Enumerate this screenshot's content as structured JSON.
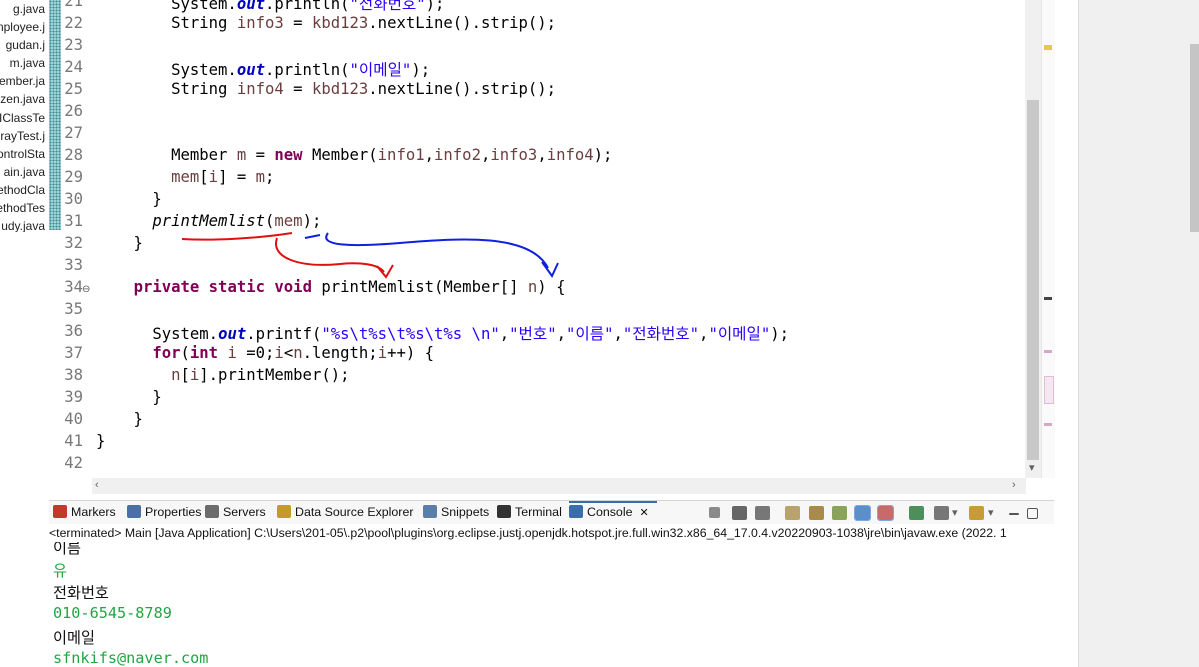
{
  "package_explorer": {
    "files": [
      "g.java",
      "nployee.j",
      "gudan.j",
      "m.java",
      "ember.ja",
      "ezen.java",
      "IClassTe",
      "rayTest.j",
      "ontrolSta",
      "ain.java",
      "ethodCla",
      "ethodTes",
      "udy.java"
    ]
  },
  "editor": {
    "lines": [
      {
        "n": "21",
        "t": [
          {
            "s": "        System."
          },
          {
            "s": "out",
            "c": "fld"
          },
          {
            "s": ".println("
          },
          {
            "s": "\"전화번호\"",
            "c": "str"
          },
          {
            "s": ");"
          }
        ]
      },
      {
        "n": "22",
        "t": [
          {
            "s": "        String "
          },
          {
            "s": "info3",
            "c": "var"
          },
          {
            "s": " = "
          },
          {
            "s": "kbd123",
            "c": "var"
          },
          {
            "s": ".nextLine().strip();"
          }
        ]
      },
      {
        "n": "23",
        "t": []
      },
      {
        "n": "24",
        "t": [
          {
            "s": "        System."
          },
          {
            "s": "out",
            "c": "fld"
          },
          {
            "s": ".println("
          },
          {
            "s": "\"이메일\"",
            "c": "str"
          },
          {
            "s": ");"
          }
        ]
      },
      {
        "n": "25",
        "t": [
          {
            "s": "        String "
          },
          {
            "s": "info4",
            "c": "var"
          },
          {
            "s": " = "
          },
          {
            "s": "kbd123",
            "c": "var"
          },
          {
            "s": ".nextLine().strip();"
          }
        ]
      },
      {
        "n": "26",
        "t": []
      },
      {
        "n": "27",
        "t": []
      },
      {
        "n": "28",
        "t": [
          {
            "s": "        Member "
          },
          {
            "s": "m",
            "c": "var"
          },
          {
            "s": " = "
          },
          {
            "s": "new",
            "c": "kw"
          },
          {
            "s": " Member("
          },
          {
            "s": "info1",
            "c": "var"
          },
          {
            "s": ","
          },
          {
            "s": "info2",
            "c": "var"
          },
          {
            "s": ","
          },
          {
            "s": "info3",
            "c": "var"
          },
          {
            "s": ","
          },
          {
            "s": "info4",
            "c": "var"
          },
          {
            "s": ");"
          }
        ]
      },
      {
        "n": "29",
        "t": [
          {
            "s": "        "
          },
          {
            "s": "mem",
            "c": "var"
          },
          {
            "s": "["
          },
          {
            "s": "i",
            "c": "var"
          },
          {
            "s": "] = "
          },
          {
            "s": "m",
            "c": "var"
          },
          {
            "s": ";"
          }
        ]
      },
      {
        "n": "30",
        "t": [
          {
            "s": "      }"
          }
        ]
      },
      {
        "n": "31",
        "t": [
          {
            "s": "      "
          },
          {
            "s": "printMemlist",
            "c": "mit"
          },
          {
            "s": "("
          },
          {
            "s": "mem",
            "c": "var"
          },
          {
            "s": ");"
          }
        ]
      },
      {
        "n": "32",
        "t": [
          {
            "s": "    }"
          }
        ]
      },
      {
        "n": "33",
        "t": []
      },
      {
        "n": "34",
        "t": [
          {
            "s": "    "
          },
          {
            "s": "private",
            "c": "kw"
          },
          {
            "s": " "
          },
          {
            "s": "static",
            "c": "kw"
          },
          {
            "s": " "
          },
          {
            "s": "void",
            "c": "kw"
          },
          {
            "s": " printMemlist(Member[] "
          },
          {
            "s": "n",
            "c": "var"
          },
          {
            "s": ") {"
          }
        ]
      },
      {
        "n": "35",
        "t": []
      },
      {
        "n": "36",
        "t": [
          {
            "s": "      System."
          },
          {
            "s": "out",
            "c": "fld"
          },
          {
            "s": ".printf("
          },
          {
            "s": "\"%s\\t%s\\t%s\\t%s \\n\"",
            "c": "str"
          },
          {
            "s": ","
          },
          {
            "s": "\"번호\"",
            "c": "str"
          },
          {
            "s": ","
          },
          {
            "s": "\"이름\"",
            "c": "str"
          },
          {
            "s": ","
          },
          {
            "s": "\"전화번호\"",
            "c": "str"
          },
          {
            "s": ","
          },
          {
            "s": "\"이메일\"",
            "c": "str"
          },
          {
            "s": ");"
          }
        ]
      },
      {
        "n": "37",
        "t": [
          {
            "s": "      "
          },
          {
            "s": "for",
            "c": "kw"
          },
          {
            "s": "("
          },
          {
            "s": "int",
            "c": "kw"
          },
          {
            "s": " "
          },
          {
            "s": "i",
            "c": "var"
          },
          {
            "s": " =0;"
          },
          {
            "s": "i",
            "c": "var"
          },
          {
            "s": "<"
          },
          {
            "s": "n",
            "c": "var"
          },
          {
            "s": ".length;"
          },
          {
            "s": "i",
            "c": "var"
          },
          {
            "s": "++) {"
          }
        ]
      },
      {
        "n": "38",
        "t": [
          {
            "s": "        "
          },
          {
            "s": "n",
            "c": "var"
          },
          {
            "s": "["
          },
          {
            "s": "i",
            "c": "var"
          },
          {
            "s": "].printMember();"
          }
        ]
      },
      {
        "n": "39",
        "t": [
          {
            "s": "      }"
          }
        ]
      },
      {
        "n": "40",
        "t": [
          {
            "s": "    }"
          }
        ]
      },
      {
        "n": "41",
        "t": [
          {
            "s": "}"
          }
        ]
      },
      {
        "n": "42",
        "t": []
      }
    ],
    "fold_marker": "⊖"
  },
  "views": {
    "tabs": [
      {
        "label": "Markers",
        "icon": "markers-icon",
        "color": "#c0392b"
      },
      {
        "label": "Properties",
        "icon": "properties-icon",
        "color": "#4a6fa5"
      },
      {
        "label": "Servers",
        "icon": "servers-icon",
        "color": "#6b6b6b"
      },
      {
        "label": "Data Source Explorer",
        "icon": "datasource-icon",
        "color": "#c49a2c"
      },
      {
        "label": "Snippets",
        "icon": "snippets-icon",
        "color": "#5b7ea8"
      },
      {
        "label": "Terminal",
        "icon": "terminal-icon",
        "color": "#333333"
      },
      {
        "label": "Console",
        "icon": "console-icon",
        "color": "#3b6ea8"
      }
    ],
    "close_glyph": "✕"
  },
  "status_line": "<terminated> Main [Java Application] C:\\Users\\201-05\\.p2\\pool\\plugins\\org.eclipse.justj.openjdk.hotspot.jre.full.win32.x86_64_17.0.4.v20220903-1038\\jre\\bin\\javaw.exe  (2022. 1",
  "console_lines": [
    {
      "text": "이름",
      "kind": "out"
    },
    {
      "text": "유",
      "kind": "in"
    },
    {
      "text": "전화번호",
      "kind": "out"
    },
    {
      "text": "010-6545-8789",
      "kind": "in"
    },
    {
      "text": "이메일",
      "kind": "out"
    },
    {
      "text": "sfnkifs@naver.com",
      "kind": "in"
    }
  ],
  "colors": {
    "annotation_red": "#e01010",
    "annotation_blue": "#1020e0",
    "console_input": "#21a642"
  }
}
